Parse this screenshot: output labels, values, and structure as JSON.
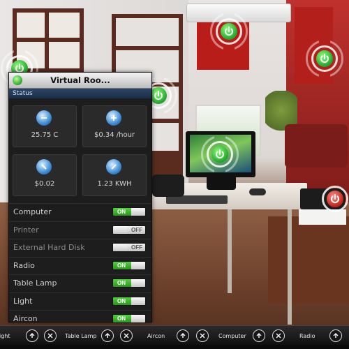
{
  "panel": {
    "title": "Virtual Roo...",
    "status_label": "Status",
    "stats": [
      {
        "value": "25.75 C",
        "icon": "thermometer-icon"
      },
      {
        "value": "$0.34 /hour",
        "icon": "dollar-rate-icon"
      },
      {
        "value": "$0.02",
        "icon": "cost-icon"
      },
      {
        "value": "1.23 KWH",
        "icon": "energy-icon"
      }
    ],
    "devices": [
      {
        "label": "Computer",
        "state": "ON"
      },
      {
        "label": "Printer",
        "state": "OFF"
      },
      {
        "label": "External Hard Disk",
        "state": "OFF"
      },
      {
        "label": "Radio",
        "state": "ON"
      },
      {
        "label": "Table Lamp",
        "state": "ON"
      },
      {
        "label": "Light",
        "state": "ON"
      },
      {
        "label": "Aircon",
        "state": "ON"
      }
    ]
  },
  "taskbar": {
    "items": [
      "ight",
      "Table Lamp",
      "Aircon",
      "Computer",
      "Radio"
    ]
  },
  "colors": {
    "on_green": "#3cb82c",
    "off_gray": "#cfcfcf",
    "power_green": "#1fa62a",
    "power_red": "#c3201b",
    "status_blue": "#22395a"
  }
}
